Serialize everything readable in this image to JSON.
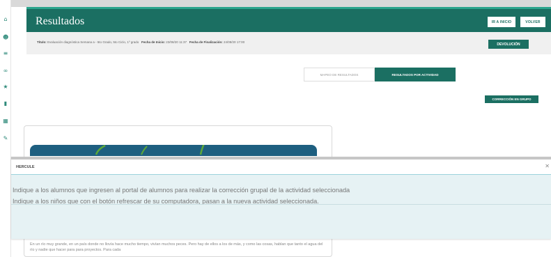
{
  "header": {
    "title": "Resultados",
    "inicio_button": "IR A INICIO",
    "volver_button": "VOLVER"
  },
  "info": {
    "title_label": "Título:",
    "title_value": "Evaluación diagnóstica Semana a - 5to Grado, 5to Ciclo, 1º grado",
    "start_label": "Fecha de Inicio:",
    "start_value": "23/08/20 11:37",
    "end_label": "Fecha de Finalización:",
    "end_value": "24/08/20 17:00",
    "devolucion_button": "DEVOLUCIÓN"
  },
  "tabs": [
    "MAPEO DE RESULTADOS",
    "RESULTADOS POR ACTIVIDAD"
  ],
  "actions": {
    "group_button": "CORRECCIÓN EN GRUPO"
  },
  "card": {
    "text": "En un río muy grande, en un país donde no llovía hace mucho tiempo, vivían muchos peces. Pero hay de ellos a los de más, y como las cosas, hablan que tanto el agua del río y nadie que hacer para para proyectos. Para cada"
  },
  "modal": {
    "title": "HERCULE",
    "close_glyph": "✕",
    "line1": "Indique a los alumnos que ingresen al portal de alumnos para realizar la corrección grupal de la actividad seleccionada",
    "line2": "Indique a los niños que con el botón refrescar de su computadora, pasan a la nueva actividad seleccionada."
  },
  "icons": [
    "home-icon",
    "users-icon",
    "list-icon",
    "link-icon",
    "star-icon",
    "book-icon",
    "grid-icon",
    "pencil-icon"
  ],
  "colors": {
    "primary": "#1b6f62",
    "accent": "#2ca58d",
    "modal_bg": "#e6f2f4"
  }
}
